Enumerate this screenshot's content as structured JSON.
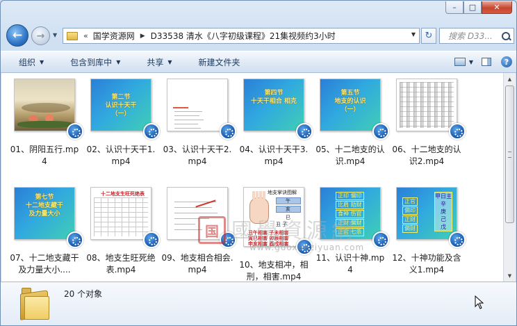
{
  "window": {
    "minimize": "–",
    "maximize": "□",
    "close": "✕"
  },
  "address": {
    "chevron": "«",
    "crumbs": [
      "国学资源网",
      "D33538 清水《八字初级课程》21集视频约3小时"
    ],
    "separator": "▶"
  },
  "search": {
    "placeholder": "搜索 D33..."
  },
  "toolbar": {
    "organize": "组织",
    "include_library": "包含到库中",
    "share": "共享",
    "new_folder": "新建文件夹",
    "dropdown_arrow": "▼"
  },
  "files": [
    {
      "label": "01、阴阳五行.mp4"
    },
    {
      "label": "02、认识十天干1.mp4",
      "thumb_lines": [
        "第二节",
        "认识十天干",
        "（一）"
      ]
    },
    {
      "label": "03、认识十天干2.mp4"
    },
    {
      "label": "04、认识十天干3.mp4",
      "thumb_lines": [
        "第四节",
        "十天干相合 相克"
      ]
    },
    {
      "label": "05、十二地支的认识.mp4",
      "thumb_lines": [
        "第五节",
        "地支的认识",
        "（一）"
      ]
    },
    {
      "label": "06、十二地支的认识2.mp4"
    },
    {
      "label": "07、十二地支藏干及力量大小....",
      "thumb_lines": [
        "第七节",
        "十二地支藏干",
        "及力量大小"
      ]
    },
    {
      "label": "08、地支生旺死绝表.mp4",
      "thumb_lines": [
        "十二地支生旺死绝表"
      ]
    },
    {
      "label": "09、地支相合相会.mp4"
    },
    {
      "label": "10、地支相冲，相刑，相害.mp4",
      "thumb_lines": [
        "地支掌诀图解",
        "午",
        "亥",
        "巳",
        "丑 子",
        "丑午相害 子未相害",
        "寅巳相害 卯辰相害",
        "申亥相害 酉戌相害"
      ]
    },
    {
      "label": "11、认识十神.mp4",
      "thumb_lines": [
        "正印 偏印",
        "比肩 劫财",
        "食神 伤官",
        "正财 偏财",
        "正官 七杀"
      ]
    },
    {
      "label": "12、十神功能及含义1.mp4",
      "thumb_lines": [
        "正官",
        "偏印",
        "正财",
        "偏财",
        "甲日主",
        "辛",
        "庚",
        "己",
        "戊"
      ]
    }
  ],
  "watermark": {
    "seal": "国",
    "title": "國學資源網",
    "url": "www.guoxueziyuan.com"
  },
  "details": {
    "count": "20 个对象"
  }
}
